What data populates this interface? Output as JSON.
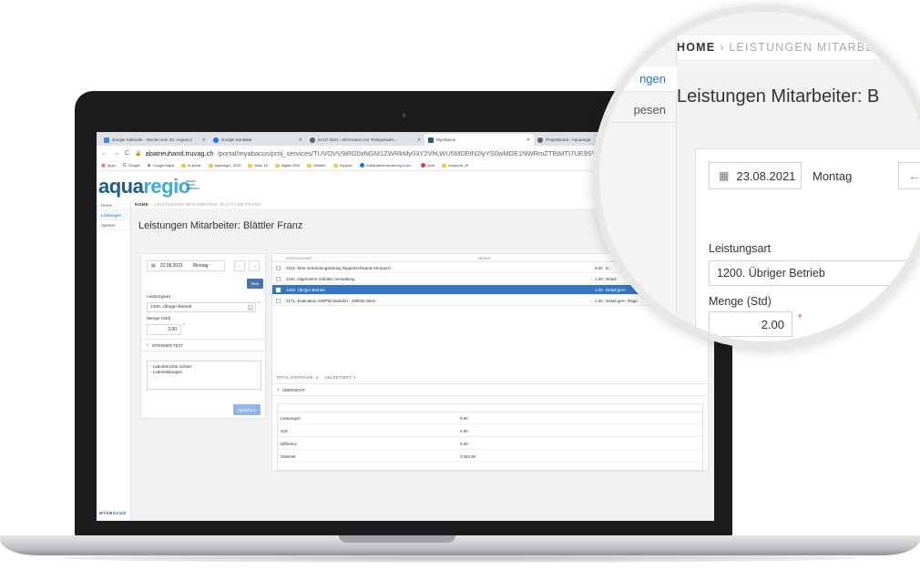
{
  "browser": {
    "tabs": [
      {
        "title": "Google Kalender - Woche vom 30. August 2",
        "fav_color": "#4285f4"
      },
      {
        "title": "Google Kontakte",
        "fav_color": "#1a73e8"
      },
      {
        "title": "24.07.2021 › Information zur Tonkausweis...",
        "fav_color": "#5f6368"
      },
      {
        "title": "MyAbacus",
        "fav_color": "#1f5d8a"
      },
      {
        "title": "Projektstand - Aquaregio",
        "fav_color": "#5f6368"
      }
    ],
    "url_host": "abatreuhand.truvag.ch",
    "url_path": "/portal/myabacus/proj_services/TUVOVV9iRD0xNGM1ZWRkMy03Y2VhLWU5MDEtN2lyYS0wMDE1NWRmZTBiMTI7UE9SVEFMX1R",
    "bookmarks": [
      {
        "label": "Apps",
        "kind": "apps"
      },
      {
        "label": "Google",
        "kind": "google"
      },
      {
        "label": "Google Maps",
        "kind": "maps"
      },
      {
        "label": "fb privat",
        "kind": "folder"
      },
      {
        "label": "aquaregio_2019",
        "kind": "folder"
      },
      {
        "label": "Allee 1b",
        "kind": "folder"
      },
      {
        "label": "digital 2020",
        "kind": "folder"
      },
      {
        "label": "Medien",
        "kind": "folder"
      },
      {
        "label": "Support",
        "kind": "folder"
      },
      {
        "label": "Gebäudeversicherung Luze...",
        "kind": "site"
      },
      {
        "label": "local",
        "kind": "site-red"
      },
      {
        "label": "temporär_f8",
        "kind": "folder"
      }
    ]
  },
  "app": {
    "logo_aqua": "aqua",
    "logo_regio": "regio",
    "logo_sub_1": "wasser",
    "logo_sub_2": "surseé",
    "logo_sub_3": "mittelland",
    "brand": "MYABACUS"
  },
  "sidebar": {
    "items": [
      {
        "label": "Home",
        "active": false
      },
      {
        "label": "Leistungen",
        "active": true
      },
      {
        "label": "Spesen",
        "active": false
      }
    ]
  },
  "breadcrumb": {
    "home": "HOME",
    "trail": "› LEISTUNGEN MITARBEITER: BLÄTTLER FRANZ"
  },
  "page": {
    "title": "Leistungen Mitarbeiter: Blättler Franz"
  },
  "form": {
    "date": "23.08.2021",
    "weekday": "Montag",
    "new_label": "Neu",
    "leistungsart_label": "Leistungsart",
    "leistungsart_value": "1200. Übriger Betrieb",
    "menge_label": "Menge (Std)",
    "menge_value": "2.00",
    "required_mark": "*",
    "internal_text_header": "INTERNER TEXT",
    "internal_text": "- Laborberichte sichten\n- Lodemeldungen",
    "save_label": "Speichern"
  },
  "table": {
    "columns": [
      "LEISTUNGSART",
      "MENGE"
    ],
    "rows": [
      {
        "name": "2152. M4a Verbindungsleitung Rippertschwand-Sempach",
        "menge": "5.00",
        "detail": "D...",
        "selected": false
      },
      {
        "name": "1100. Allgemeine Arbeiten Verwaltung",
        "menge": "1.00",
        "detail": "Detail",
        "selected": false
      },
      {
        "name": "1200. Übriger Betrieb",
        "menge": "2.00",
        "detail": "Detail gem",
        "selected": true
      },
      {
        "name": "2171. Evaluation GWPW Standort - Zellfeld West",
        "menge": "1.00",
        "detail": "Detail gem. Rapp",
        "selected": false
      }
    ],
    "totals": "TOTAL EINTRÄGE: 4     SELEKTIERT: 1"
  },
  "overview": {
    "header": "ÜBERSICHT",
    "rows": [
      {
        "label": "Leistungen",
        "value": "9.00"
      },
      {
        "label": "Soll",
        "value": "0.00"
      },
      {
        "label": "Differenz",
        "value": "9.00"
      },
      {
        "label": "Gleitzeit",
        "value": "1'364.50"
      }
    ]
  },
  "zoom": {
    "sidebar_items": [
      "ngen",
      "pesen"
    ],
    "crumb_home": "HOME",
    "crumb_trail": "› LEISTUNGEN MITARBEIT",
    "title": "Leistungen Mitarbeiter: B",
    "date": "23.08.2021",
    "weekday": "Montag",
    "back_arrow": "←",
    "leistungsart_label": "Leistungsart",
    "leistungsart_value": "1200. Übriger Betrieb",
    "menge_label": "Menge (Std)",
    "menge_value": "2.00",
    "required_mark": "*"
  }
}
